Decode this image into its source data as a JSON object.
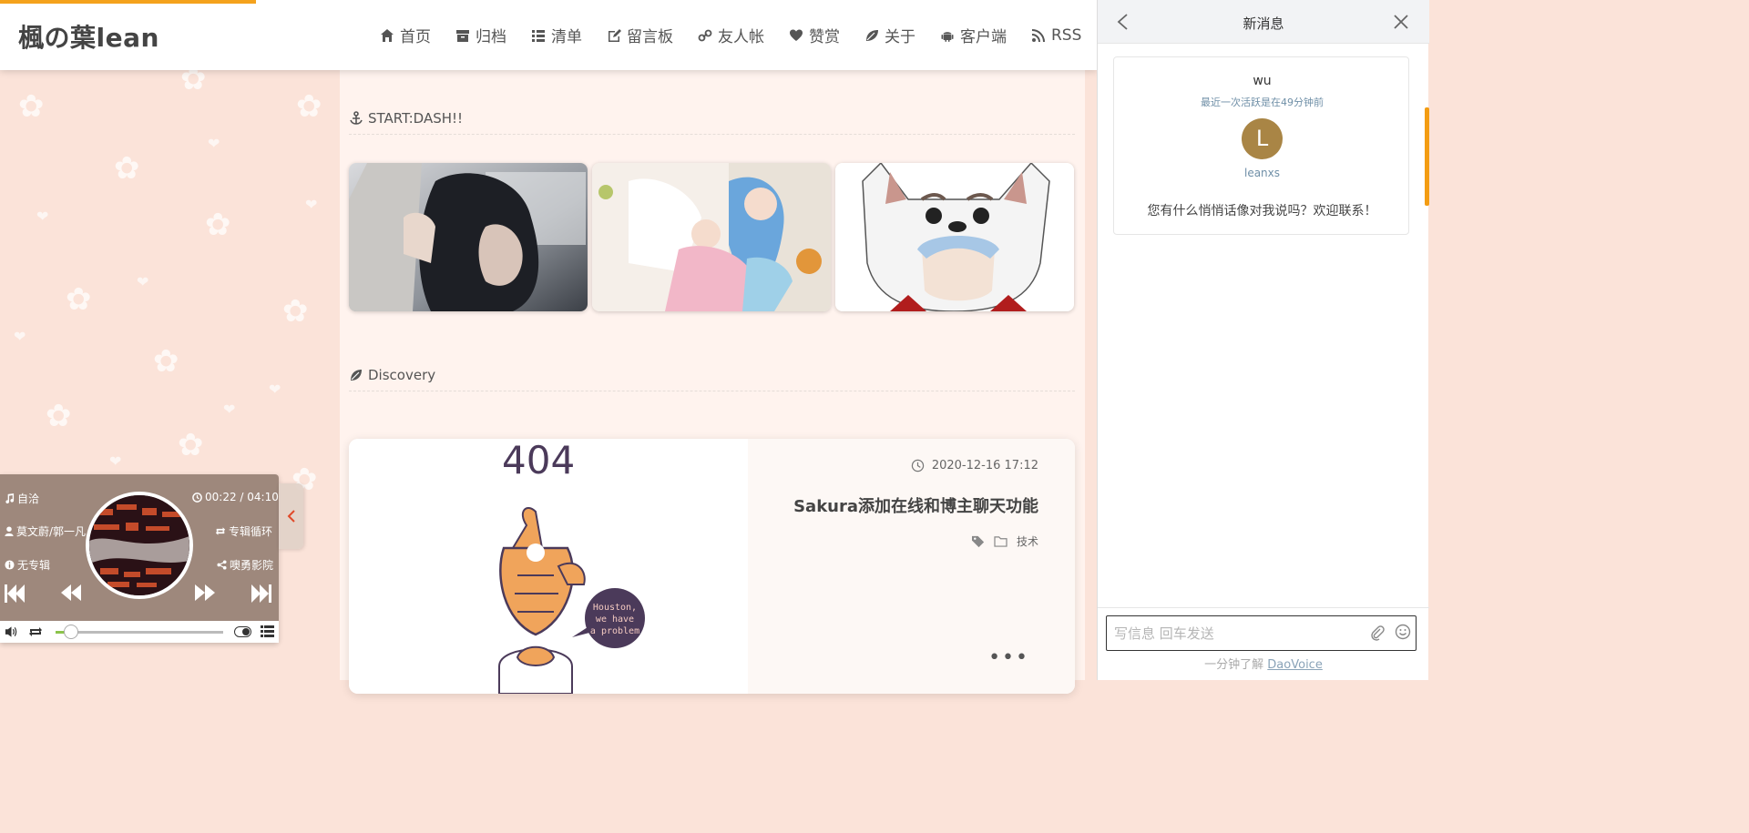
{
  "header": {
    "site_title": "楓の葉lean",
    "nav": [
      {
        "label": "首页",
        "icon": "home-icon"
      },
      {
        "label": "归档",
        "icon": "archive-icon"
      },
      {
        "label": "清单",
        "icon": "list-icon"
      },
      {
        "label": "留言板",
        "icon": "edit-icon"
      },
      {
        "label": "友人帐",
        "icon": "link-icon"
      },
      {
        "label": "赞赏",
        "icon": "heart-icon"
      },
      {
        "label": "关于",
        "icon": "leaf-icon"
      },
      {
        "label": "客户端",
        "icon": "android-icon"
      },
      {
        "label": "RSS",
        "icon": "rss-icon"
      }
    ]
  },
  "sections": {
    "start_dash": "START:DASH!!",
    "discovery": "Discovery"
  },
  "featured": [
    {
      "name": "featured-anime-girl-dark-hair"
    },
    {
      "name": "featured-anime-girls-pink-blue"
    },
    {
      "name": "featured-gintoki-dog-hat"
    }
  ],
  "post": {
    "date": "2020-12-16 17:12",
    "title": "Sakura添加在线和博主聊天功能",
    "category": "技术",
    "thumb_text_404": "404",
    "thumb_bubble": [
      "Houston,",
      "we have",
      "a problem"
    ],
    "more": "•••"
  },
  "player": {
    "song": "自洽",
    "time": "00:22 / 04:10",
    "artist": "莫文蔚/郭一凡",
    "loop_mode": "专辑循环",
    "album": "无专辑",
    "share": "噢勇影院",
    "progress_fraction": 0.09
  },
  "chat": {
    "title": "新消息",
    "agent_name": "wu",
    "agent_active": "最近一次活跃是在49分钟前",
    "avatar_letter": "L",
    "agent_handle": "leanxs",
    "greeting": "您有什么悄悄话像对我说吗？欢迎联系！",
    "input_placeholder": "写信息 回车发送",
    "powered_prefix": "一分钟了解 ",
    "powered_link": "DaoVoice"
  },
  "colors": {
    "accent": "#f4a21d",
    "background": "#fbe3d9",
    "avatar": "#a98545",
    "chat_scrollbar": "#f39c12"
  }
}
